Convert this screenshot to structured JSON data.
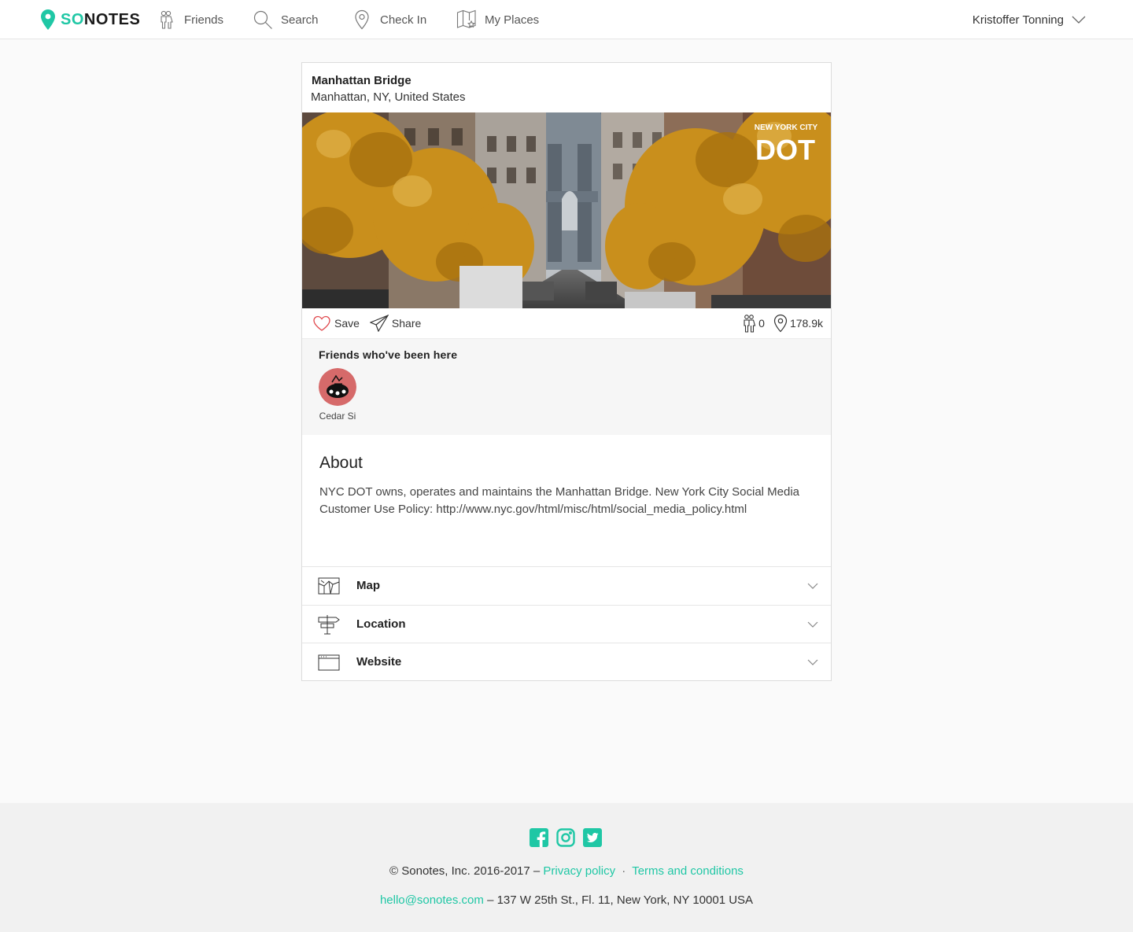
{
  "header": {
    "logo_so": "SO",
    "logo_rest": "NOTES",
    "nav": [
      {
        "label": "Friends",
        "icon": "friends-icon"
      },
      {
        "label": "Search",
        "icon": "search-icon"
      },
      {
        "label": "Check In",
        "icon": "map-pin-icon"
      },
      {
        "label": "My Places",
        "icon": "map-star-icon"
      }
    ],
    "user_name": "Kristoffer Tonning"
  },
  "place": {
    "title": "Manhattan Bridge",
    "subtitle": "Manhattan, NY, United States",
    "photo_watermark_top": "NEW YORK CITY",
    "photo_watermark_main": "DOT"
  },
  "actions": {
    "save_label": "Save",
    "share_label": "Share",
    "friends_count": "0",
    "checkins_count": "178.9k"
  },
  "friends": {
    "title": "Friends who've been here",
    "list": [
      {
        "name": "Cedar Si"
      }
    ]
  },
  "about": {
    "title": "About",
    "text": "NYC DOT owns, operates and maintains the Manhattan Bridge. New York City Social Media Customer Use Policy: http://www.nyc.gov/html/misc/html/social_media_policy.html"
  },
  "sections": [
    {
      "label": "Map",
      "icon": "map-icon"
    },
    {
      "label": "Location",
      "icon": "signpost-icon"
    },
    {
      "label": "Website",
      "icon": "browser-window-icon"
    }
  ],
  "footer": {
    "copyright": "© Sonotes, Inc. 2016-2017 –",
    "privacy": "Privacy policy",
    "separator": "·",
    "terms": "Terms and conditions",
    "email": "hello@sonotes.com",
    "address": "– 137 W 25th St., Fl. 11, New York, NY 10001 USA"
  },
  "colors": {
    "brand": "#1fc7a5",
    "heart": "#e0474c"
  }
}
